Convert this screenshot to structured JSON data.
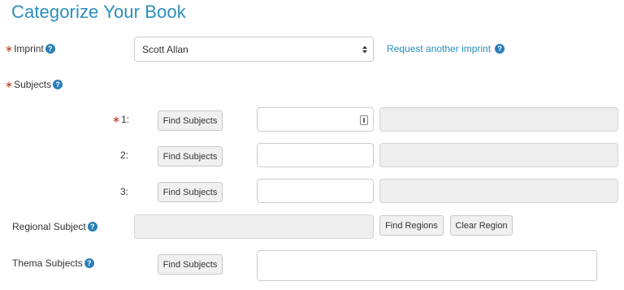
{
  "page_title": "Categorize Your Book",
  "imprint": {
    "label": "Imprint",
    "selected": "Scott Allan",
    "request_link": "Request another imprint"
  },
  "subjects": {
    "label": "Subjects",
    "rows": [
      {
        "number": "1:",
        "button": "Find Subjects"
      },
      {
        "number": "2:",
        "button": "Find Subjects"
      },
      {
        "number": "3:",
        "button": "Find Subjects"
      }
    ]
  },
  "regional": {
    "label": "Regional Subject",
    "find_button": "Find Regions",
    "clear_button": "Clear Region"
  },
  "thema": {
    "label": "Thema Subjects",
    "button": "Find Subjects"
  },
  "colors": {
    "accent": "#2a8fbd",
    "required": "#c0392b",
    "help_icon": "#2a7fb8"
  }
}
